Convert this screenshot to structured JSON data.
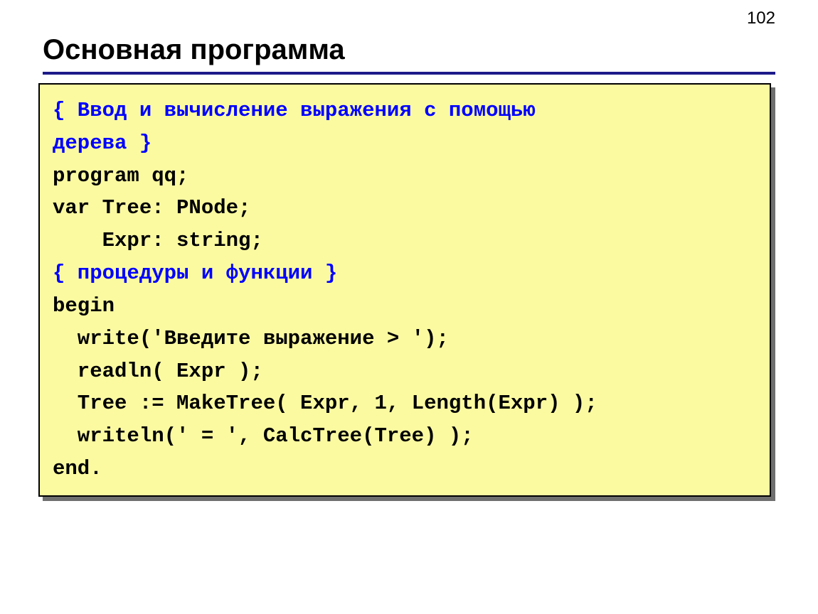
{
  "page_number": "102",
  "title": "Основная программа",
  "code": {
    "comment1a": "{ Ввод и вычисление выражения с помощью",
    "comment1b": "дерева }",
    "line1": "program qq;",
    "line2": "var Tree: PNode;",
    "line3": "    Expr: string;",
    "comment2": "{ процедуры и функции }",
    "line4": "begin",
    "line5": "  write('Введите выражение > ');",
    "line6": "  readln( Expr );",
    "line7": "  Tree := MakeTree( Expr, 1, Length(Expr) );",
    "line8": "  writeln(' = ', CalcTree(Tree) );",
    "line9": "end."
  }
}
